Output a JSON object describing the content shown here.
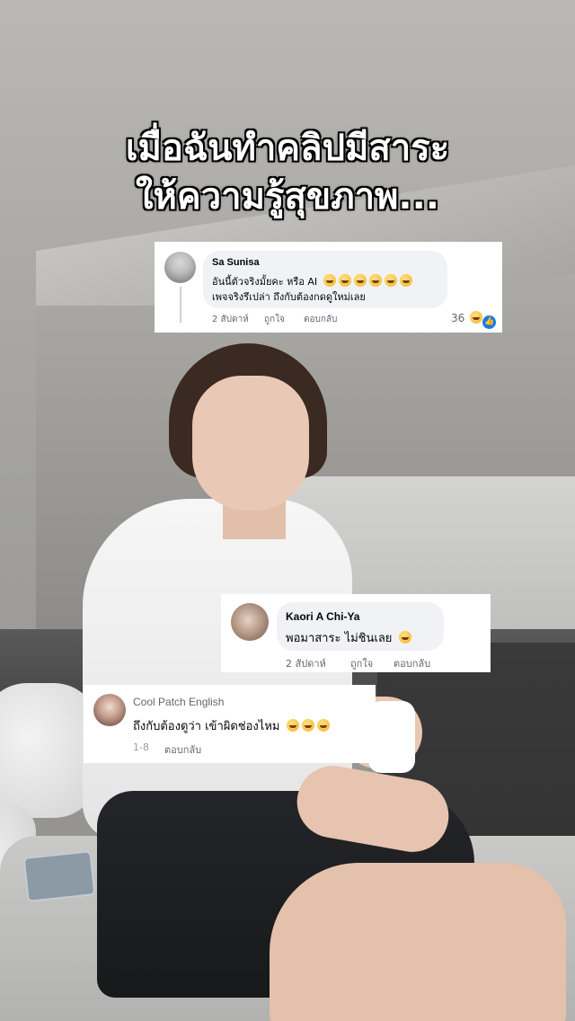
{
  "headline": {
    "line1": "เมื่อฉันทำคลิปมีสาระ",
    "line2": "ให้ความรู้สุขภาพ..."
  },
  "comments": [
    {
      "author": "Sa Sunisa",
      "line1": "อันนี้ตัวจริงมั้ยคะ หรือ AI",
      "line2": "เพจจริงรึเปล่า ถึงกับต้องกดดูใหม่เลย",
      "time": "2 สัปดาห์",
      "like_label": "ถูกใจ",
      "reply_label": "ตอบกลับ",
      "reaction_count": "36",
      "emoji_count": 6
    },
    {
      "author": "Kaori A Chi-Ya",
      "line1": "พอมาสาระ ไม่ชินเลย",
      "time": "2 สัปดาห์",
      "like_label": "ถูกใจ",
      "reply_label": "ตอบกลับ",
      "emoji_count": 1
    },
    {
      "author": "Cool Patch English",
      "line1": "ถึงกับต้องดูว่า เข้าผิดช่องไหม",
      "time": "1-8",
      "reply_label": "ตอบกลับ",
      "emoji_count": 3
    }
  ],
  "colors": {
    "card_bg": "#ffffff",
    "bubble_bg": "#f0f2f5",
    "meta_text": "#65676b",
    "like_blue": "#1877f2"
  }
}
